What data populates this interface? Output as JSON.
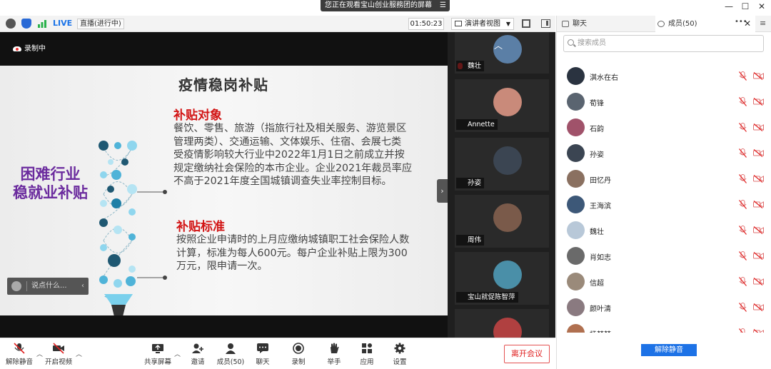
{
  "window": {
    "share_banner": "您正在观看宝山创业服務团的屏幕",
    "controls": {
      "minimize": "—",
      "maximize": "☐",
      "close": "✕"
    }
  },
  "status_bar": {
    "live_badge": "LIVE",
    "live_status": "直播(进行中)",
    "timer": "01:50:23",
    "view_mode": "演讲者视图"
  },
  "video": {
    "recording_label": "录制中",
    "chat_placeholder": "说点什么..."
  },
  "slide": {
    "title": "疫情稳岗补贴",
    "left_title_1": "困难行业",
    "left_title_2": "稳就业补贴",
    "section1_head": "补贴对象",
    "section1_lines": [
      "餐饮、零售、旅游（指旅行社及相关服务、游览景区",
      "管理两类）、交通运输、文体娱乐、住宿、会展七类",
      "受疫情影响较大行业中2022年1月1日之前成立并按",
      "规定缴纳社会保险的本市企业。企业2021年裁员率应",
      "不高于2021年度全国城镇调查失业率控制目标。"
    ],
    "section2_head": "补贴标准",
    "section2_lines": [
      "按照企业申请时的上月应缴纳城镇职工社会保险人数",
      "计算，标准为每人600元。每户企业补贴上限为300",
      "万元，限申请一次。"
    ]
  },
  "video_tiles": [
    {
      "name": "魏壮",
      "avatar_color": "#5b7fa6"
    },
    {
      "name": "Annette",
      "avatar_color": "#c98a7a"
    },
    {
      "name": "孙姿",
      "avatar_color": "#3b4552"
    },
    {
      "name": "周伟",
      "avatar_color": "#7a5a4a"
    },
    {
      "name": "宝山就促陈智萍",
      "avatar_color": "#4a8fa8"
    },
    {
      "name": "",
      "avatar_color": "#b04040"
    }
  ],
  "toolbar": {
    "mute": "解除静音",
    "video": "开启视频",
    "share": "共享屏幕",
    "invite": "邀请",
    "members": "成员(50)",
    "chat": "聊天",
    "record": "录制",
    "raise_hand": "举手",
    "apps": "应用",
    "settings": "设置",
    "leave": "离开会议"
  },
  "panel": {
    "tab_chat": "聊天",
    "tab_members": "成员(50)",
    "tab_more": "•••",
    "tab_close": "✕",
    "menu": "≡",
    "search_placeholder": "搜索成员",
    "members": [
      {
        "name": "淇水在右",
        "avatar_color": "#2a3340"
      },
      {
        "name": "荀锋",
        "avatar_color": "#5a6470"
      },
      {
        "name": "石韵",
        "avatar_color": "#a0526a"
      },
      {
        "name": "孙姿",
        "avatar_color": "#3b4552"
      },
      {
        "name": "田忆丹",
        "avatar_color": "#8a7060"
      },
      {
        "name": "王海滨",
        "avatar_color": "#3d5878"
      },
      {
        "name": "魏壮",
        "avatar_color": "#b8c8d8"
      },
      {
        "name": "肖如志",
        "avatar_color": "#6a6a6a"
      },
      {
        "name": "信超",
        "avatar_color": "#9a8a7a"
      },
      {
        "name": "颜叶清",
        "avatar_color": "#8a7a80"
      },
      {
        "name": "杨梦梦",
        "avatar_color": "#b07050"
      }
    ],
    "unmute_all": "解除静音"
  },
  "colors": {
    "accent": "#1d72e6",
    "danger": "#e02020",
    "slide_heading": "#d21414",
    "slide_left_title": "#6b2b9e"
  }
}
